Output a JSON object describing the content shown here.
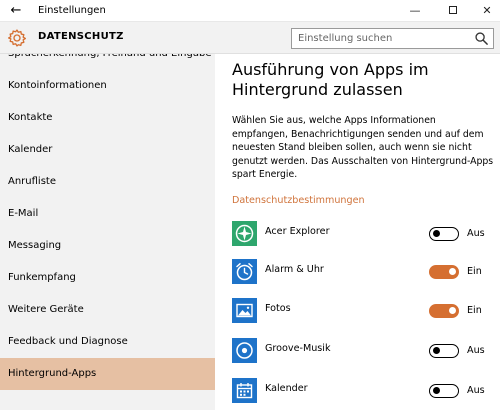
{
  "window": {
    "back_glyph": "←",
    "title": "Einstellungen",
    "minimize_glyph": "—",
    "close_glyph": "✕"
  },
  "header": {
    "title": "DATENSCHUTZ",
    "icon": "gear-icon",
    "search_placeholder": "Einstellung suchen",
    "search_icon": "search-icon"
  },
  "sidebar": {
    "items": [
      {
        "label": "Spracherkennung, Freihand und Eingabe"
      },
      {
        "label": "Kontoinformationen"
      },
      {
        "label": "Kontakte"
      },
      {
        "label": "Kalender"
      },
      {
        "label": "Anrufliste"
      },
      {
        "label": "E-Mail"
      },
      {
        "label": "Messaging"
      },
      {
        "label": "Funkempfang"
      },
      {
        "label": "Weitere Geräte"
      },
      {
        "label": "Feedback und Diagnose"
      },
      {
        "label": "Hintergrund-Apps",
        "active": true
      }
    ]
  },
  "main": {
    "title": "Ausführung von Apps im Hintergrund zulassen",
    "description": "Wählen Sie aus, welche Apps Informationen empfangen, Benachrichtigungen senden und auf dem neuesten Stand bleiben sollen, auch wenn sie nicht genutzt werden. Das Ausschalten von Hintergrund-Apps spart Energie.",
    "section_link": "Datenschutzbestimmungen",
    "apps": [
      {
        "name": "Acer Explorer",
        "icon": "acer-explorer-icon",
        "on": false,
        "state_label": "Aus",
        "icon_color": "#2ea66d"
      },
      {
        "name": "Alarm & Uhr",
        "icon": "alarm-clock-icon",
        "on": true,
        "state_label": "Ein",
        "icon_color": "#1e73c9"
      },
      {
        "name": "Fotos",
        "icon": "photos-icon",
        "on": true,
        "state_label": "Ein",
        "icon_color": "#1e73c9"
      },
      {
        "name": "Groove-Musik",
        "icon": "groove-music-icon",
        "on": false,
        "state_label": "Aus",
        "icon_color": "#1e73c9"
      },
      {
        "name": "Kalender",
        "icon": "calendar-icon",
        "on": false,
        "state_label": "Aus",
        "icon_color": "#1e73c9"
      }
    ]
  },
  "colors": {
    "accent": "#d56f31",
    "active_nav": "#e6c0a3",
    "link": "#d0743c",
    "panel": "#f2f2f2"
  }
}
